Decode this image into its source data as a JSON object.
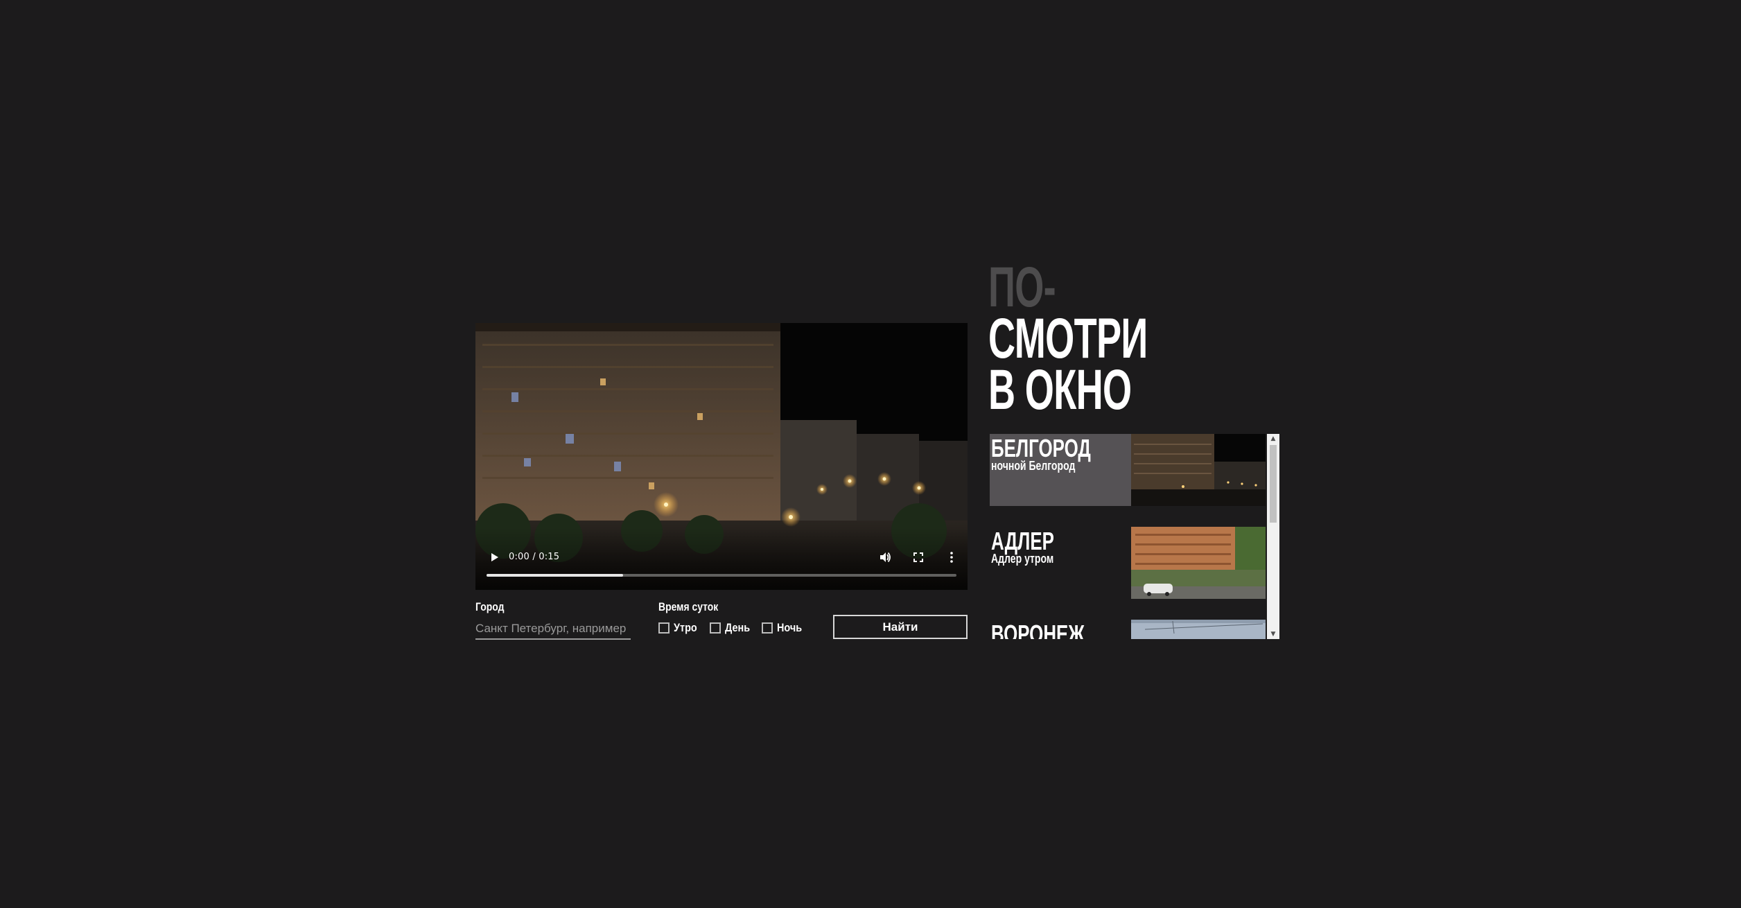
{
  "player": {
    "time": "0:00 / 0:15",
    "progress": 0.29
  },
  "form": {
    "city_label": "Город",
    "city_placeholder": "Санкт Петербург, например",
    "time_label": "Время суток",
    "options": [
      "Утро",
      "День",
      "Ночь"
    ],
    "submit_label": "Найти"
  },
  "headline": {
    "line1": "ПО-",
    "line2": "СМОТРИ",
    "line3": "В ОКНО"
  },
  "cities": [
    {
      "name": "БЕЛГОРОД",
      "subtitle": "ночной Белгород",
      "active": true
    },
    {
      "name": "АДЛЕР",
      "subtitle": "Адлер утром",
      "active": false
    },
    {
      "name": "ВОРОНЕЖ",
      "subtitle": "",
      "active": false
    }
  ],
  "colors": {
    "background": "#1c1b1c",
    "headline_dim": "#4d4c4d",
    "active_item": "#555255"
  },
  "icons": {
    "play": "play-icon",
    "volume": "volume-icon",
    "fullscreen": "fullscreen-icon",
    "more": "more-vert-icon"
  }
}
